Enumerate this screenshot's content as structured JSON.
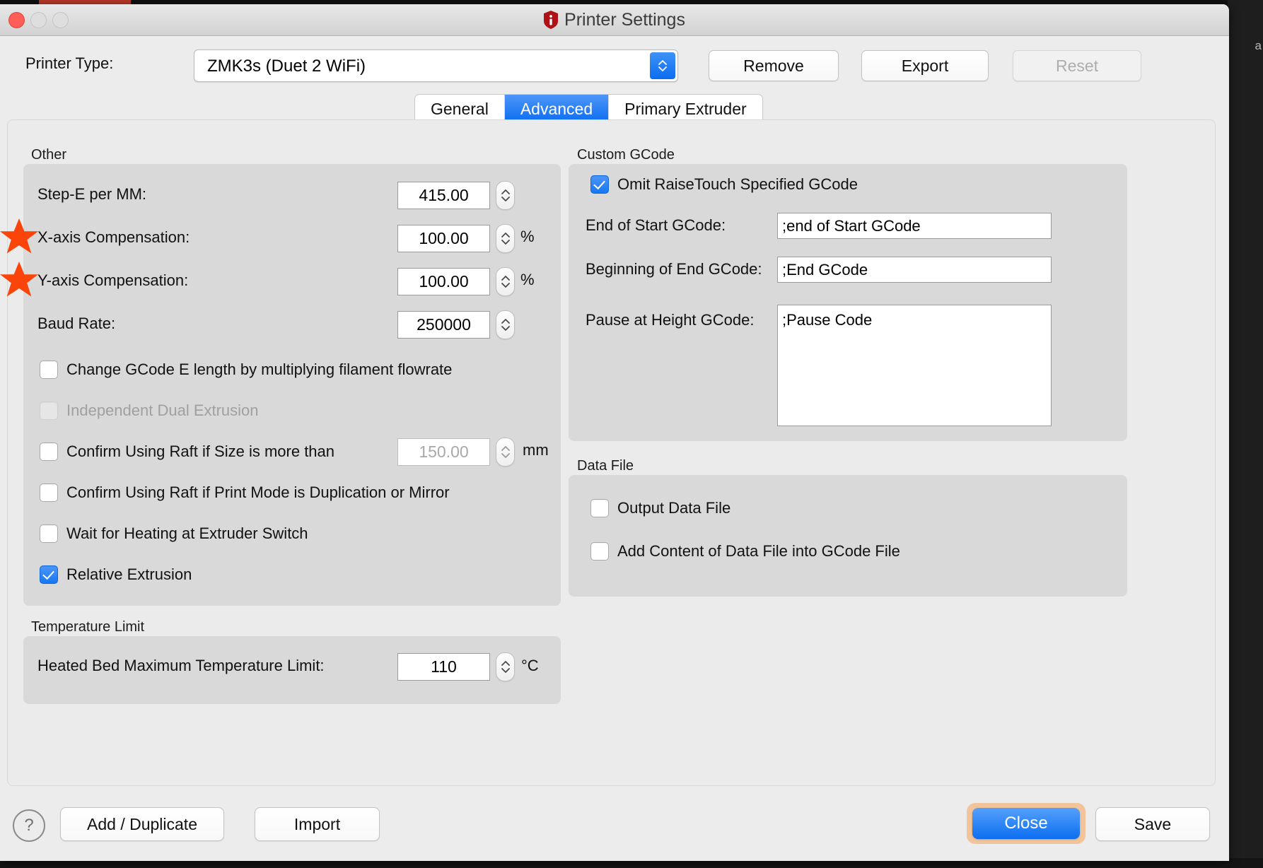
{
  "window": {
    "title": "Printer Settings",
    "app_icon": "info-shield-icon",
    "traffic_lights": [
      "close",
      "minimize",
      "maximize"
    ],
    "desktop_ghost_text": "a"
  },
  "toolbar": {
    "printer_type_label": "Printer Type:",
    "printer_type_value": "ZMK3s (Duet 2 WiFi)",
    "buttons": [
      {
        "name": "remove",
        "label": "Remove",
        "enabled": true
      },
      {
        "name": "export",
        "label": "Export",
        "enabled": true
      },
      {
        "name": "reset",
        "label": "Reset",
        "enabled": false
      }
    ]
  },
  "tabs": [
    {
      "label": "General",
      "active": false
    },
    {
      "label": "Advanced",
      "active": true
    },
    {
      "label": "Primary Extruder",
      "active": false
    }
  ],
  "left": {
    "other_group_title": "Other",
    "step_e_label": "Step-E per MM:",
    "step_e_value": "415.00",
    "x_comp_label": "X-axis Compensation:",
    "x_comp_value": "100.00",
    "x_comp_unit": "%",
    "y_comp_label": "Y-axis Compensation:",
    "y_comp_value": "100.00",
    "y_comp_unit": "%",
    "baud_label": "Baud Rate:",
    "baud_value": "250000",
    "cb_change_gcode": "Change GCode E length by multiplying filament flowrate",
    "cb_independent_dual": "Independent Dual Extrusion",
    "cb_raft_size": "Confirm Using Raft if Size is more than",
    "raft_size_value": "150.00",
    "raft_size_unit": "mm",
    "cb_raft_mode": "Confirm Using Raft if Print Mode is Duplication or Mirror",
    "cb_wait_heating": "Wait for Heating at Extruder Switch",
    "cb_relative_extrusion": "Relative Extrusion",
    "temp_group_title": "Temperature Limit",
    "bed_temp_label": "Heated Bed Maximum Temperature Limit:",
    "bed_temp_value": "110",
    "bed_temp_unit": "°C"
  },
  "right": {
    "gcode_group_title": "Custom GCode",
    "cb_omit_raisetouch": "Omit RaiseTouch Specified GCode",
    "end_start_label": "End of Start GCode:",
    "end_start_value": ";end of Start GCode",
    "begin_end_label": "Beginning of End GCode:",
    "begin_end_value": ";End GCode",
    "pause_label": "Pause at Height GCode:",
    "pause_value": ";Pause Code",
    "datafile_group_title": "Data File",
    "cb_output_data": "Output Data File",
    "cb_add_content": "Add Content of Data File into GCode File"
  },
  "footer": {
    "help_label": "?",
    "add_duplicate": "Add / Duplicate",
    "import": "Import",
    "close": "Close",
    "save": "Save"
  },
  "annotations": {
    "star_color": "#fb4409",
    "stars": [
      "x-axis-compensation",
      "y-axis-compensation"
    ]
  },
  "colors": {
    "accent_blue": "#0b6cf0",
    "focus_ring": "#f2c49b",
    "window_bg": "#ececec",
    "group_bg": "#d9d9d9"
  }
}
